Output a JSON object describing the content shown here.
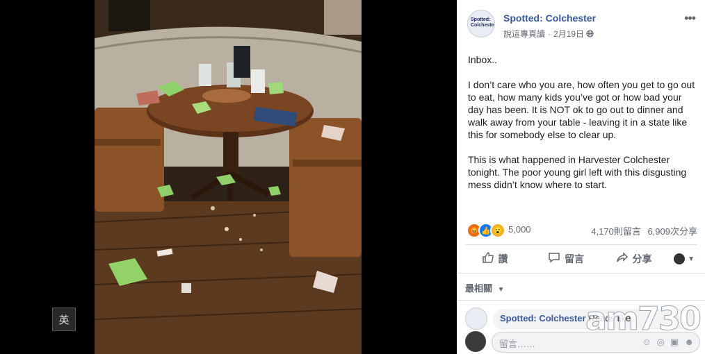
{
  "post": {
    "page_name": "Spotted: Colchester",
    "avatar_text": "Spotted: Colchester",
    "see_translation": "說這專頁讀",
    "date": "2月19日",
    "privacy_icon": "globe-icon",
    "body_1": "Inbox..",
    "body_2": "I don’t care who you are, how often you get to go out to eat, how many kids you’ve got or how bad your day has been. It is NOT ok to go out to dinner and walk away from your table - leaving it in a state like this for somebody else to clear up.",
    "body_3": "This is what happened in Harvester Colchester tonight. The poor young girl left with this disgusting mess didn’t know where to start."
  },
  "reactions": {
    "count": "5,000",
    "comments": "4,170則留言",
    "shares": "6,909次分享",
    "icons": [
      "angry-icon",
      "like-icon",
      "wow-icon"
    ]
  },
  "actions": {
    "like": "讚",
    "comment": "留言",
    "share": "分享"
  },
  "comments": {
    "sort_label": "最相關",
    "first_name": "Spotted: Colchester",
    "first_text": "Reads like",
    "composer_placeholder": "留言……"
  },
  "viewer": {
    "lang_badge": "英"
  },
  "watermark": "am730"
}
